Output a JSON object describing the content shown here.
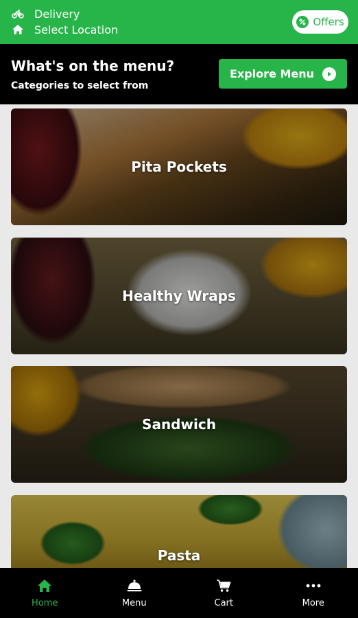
{
  "topbar": {
    "delivery_label": "Delivery",
    "location_label": "Select Location",
    "delivery_icon": "bicycle-icon",
    "location_icon": "home-icon",
    "offers_label": "Offers",
    "offers_icon": "percent-badge-icon"
  },
  "menu_header": {
    "title": "What's on the menu?",
    "subtitle": "Categories to select from",
    "explore_label": "Explore Menu",
    "explore_icon": "play-circle-icon"
  },
  "categories": [
    {
      "label": "Pita Pockets"
    },
    {
      "label": "Healthy Wraps"
    },
    {
      "label": "Sandwich"
    },
    {
      "label": "Pasta"
    }
  ],
  "bottom_nav": {
    "items": [
      {
        "label": "Home",
        "icon": "home-icon",
        "active": true
      },
      {
        "label": "Menu",
        "icon": "cloche-icon",
        "active": false
      },
      {
        "label": "Cart",
        "icon": "cart-icon",
        "active": false
      },
      {
        "label": "More",
        "icon": "more-dots-icon",
        "active": false
      }
    ]
  },
  "colors": {
    "brand_green": "#27b54a",
    "header_black": "#000000",
    "background": "#e9e9e9"
  }
}
